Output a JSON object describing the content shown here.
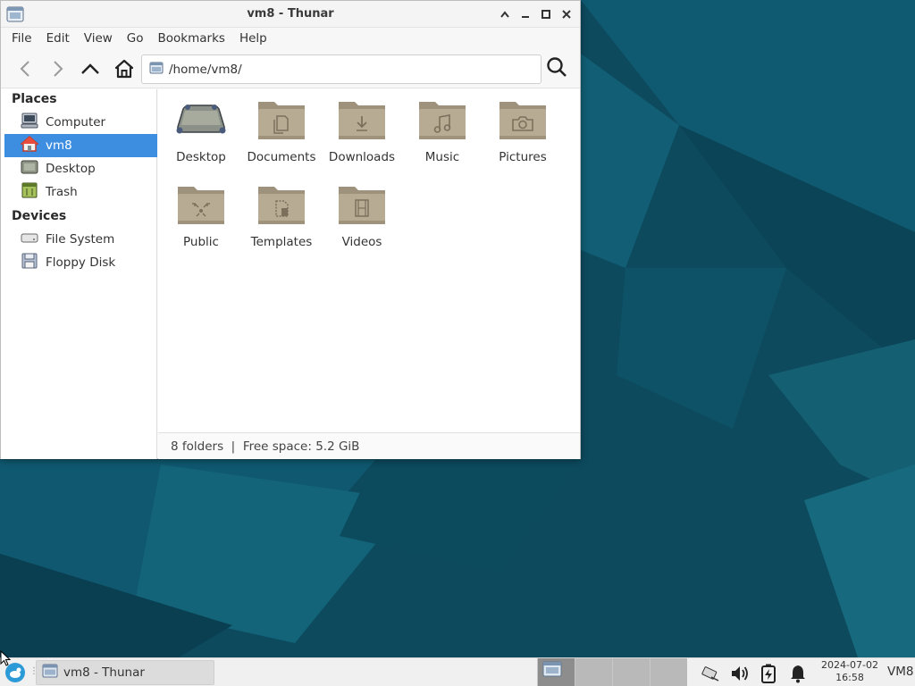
{
  "window": {
    "title": "vm8 - Thunar"
  },
  "menubar": {
    "items": [
      "File",
      "Edit",
      "View",
      "Go",
      "Bookmarks",
      "Help"
    ]
  },
  "toolbar": {
    "path": "/home/vm8/"
  },
  "sidebar": {
    "places_heading": "Places",
    "places": [
      {
        "label": "Computer",
        "icon": "computer-icon"
      },
      {
        "label": "vm8",
        "icon": "home-icon",
        "selected": true
      },
      {
        "label": "Desktop",
        "icon": "desktop-icon"
      },
      {
        "label": "Trash",
        "icon": "trash-icon"
      }
    ],
    "devices_heading": "Devices",
    "devices": [
      {
        "label": "File System",
        "icon": "drive-icon"
      },
      {
        "label": "Floppy Disk",
        "icon": "floppy-icon"
      }
    ]
  },
  "content": {
    "folders": [
      {
        "label": "Desktop",
        "icon": "desktop-folder-icon"
      },
      {
        "label": "Documents",
        "icon": "documents-folder-icon"
      },
      {
        "label": "Downloads",
        "icon": "downloads-folder-icon"
      },
      {
        "label": "Music",
        "icon": "music-folder-icon"
      },
      {
        "label": "Pictures",
        "icon": "pictures-folder-icon"
      },
      {
        "label": "Public",
        "icon": "public-folder-icon"
      },
      {
        "label": "Templates",
        "icon": "templates-folder-icon"
      },
      {
        "label": "Videos",
        "icon": "videos-folder-icon"
      }
    ]
  },
  "statusbar": {
    "text": "8 folders  |  Free space: 5.2 GiB"
  },
  "taskbar": {
    "task_label": "vm8 - Thunar",
    "clock_date": "2024-07-02",
    "clock_time": "16:58",
    "user": "VM8"
  },
  "colors": {
    "selection": "#3d8ee0",
    "folder": "#b8ab94",
    "desktop_bg": "#0e4f64"
  }
}
